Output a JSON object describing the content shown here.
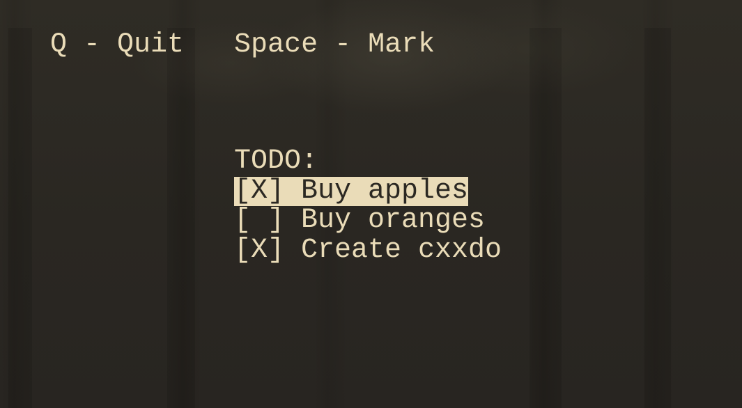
{
  "help": {
    "quit": "Q - Quit",
    "mark": "Space - Mark"
  },
  "todo": {
    "title": "TODO:",
    "items": [
      {
        "text": "[X] Buy apples",
        "checked": true,
        "selected": true
      },
      {
        "text": "[ ] Buy oranges",
        "checked": false,
        "selected": false
      },
      {
        "text": "[X] Create cxxdo",
        "checked": true,
        "selected": false
      }
    ]
  },
  "colors": {
    "foreground": "#eadcb8",
    "background": "#2b2822",
    "selection_background": "#eadcb8",
    "selection_foreground": "#2b2822"
  }
}
